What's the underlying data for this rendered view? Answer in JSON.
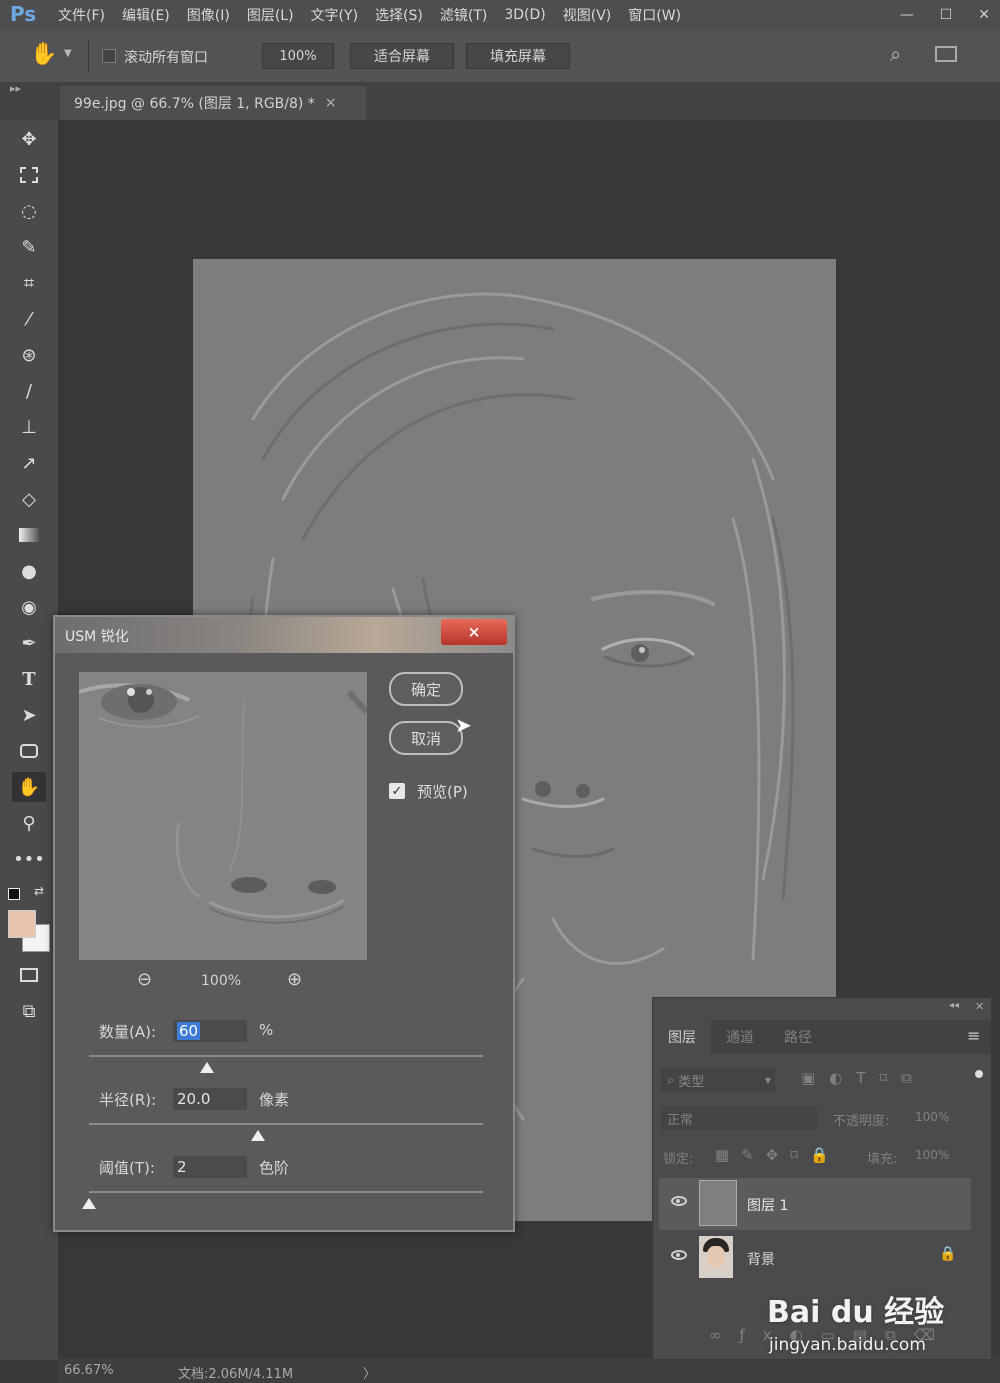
{
  "app": {
    "logo": "Ps",
    "menus": [
      "文件(F)",
      "编辑(E)",
      "图像(I)",
      "图层(L)",
      "文字(Y)",
      "选择(S)",
      "滤镜(T)",
      "3D(D)",
      "视图(V)",
      "窗口(W)"
    ]
  },
  "options_bar": {
    "scroll_all_label": "滚动所有窗口",
    "zoom_value": "100%",
    "fit_screen": "适合屏幕",
    "fill_screen": "填充屏幕"
  },
  "document": {
    "tab_title": "99e.jpg @ 66.7% (图层 1, RGB/8) *",
    "tab_close": "×"
  },
  "status_bar": {
    "zoom": "66.67%",
    "doc_info": "文档:2.06M/4.11M",
    "arrow": "〉"
  },
  "dialog": {
    "title": "USM 锐化",
    "close": "×",
    "ok": "确定",
    "cancel": "取消",
    "preview_label": "预览(P)",
    "preview_checked": true,
    "preview_zoom": "100%",
    "amount_label": "数量(A):",
    "amount_value": "60",
    "amount_unit": "%",
    "amount_slider_fraction": 0.3,
    "radius_label": "半径(R):",
    "radius_value": "20.0",
    "radius_unit": "像素",
    "radius_slider_fraction": 0.43,
    "threshold_label": "阈值(T):",
    "threshold_value": "2",
    "threshold_unit": "色阶",
    "threshold_slider_fraction": 0.0
  },
  "layers_panel": {
    "tabs": [
      "图层",
      "通道",
      "路径"
    ],
    "filter_kind": "类型",
    "blend_mode": "正常",
    "opacity_label": "不透明度:",
    "opacity_value": "100%",
    "lock_label": "锁定:",
    "fill_label": "填充:",
    "fill_value": "100%",
    "layers": [
      {
        "name": "图层 1",
        "visible": true,
        "selected": true,
        "locked": false
      },
      {
        "name": "背景",
        "visible": true,
        "selected": false,
        "locked": true
      }
    ]
  },
  "watermark": {
    "brand": "Bai du 经验",
    "url": "jingyan.baidu.com"
  }
}
